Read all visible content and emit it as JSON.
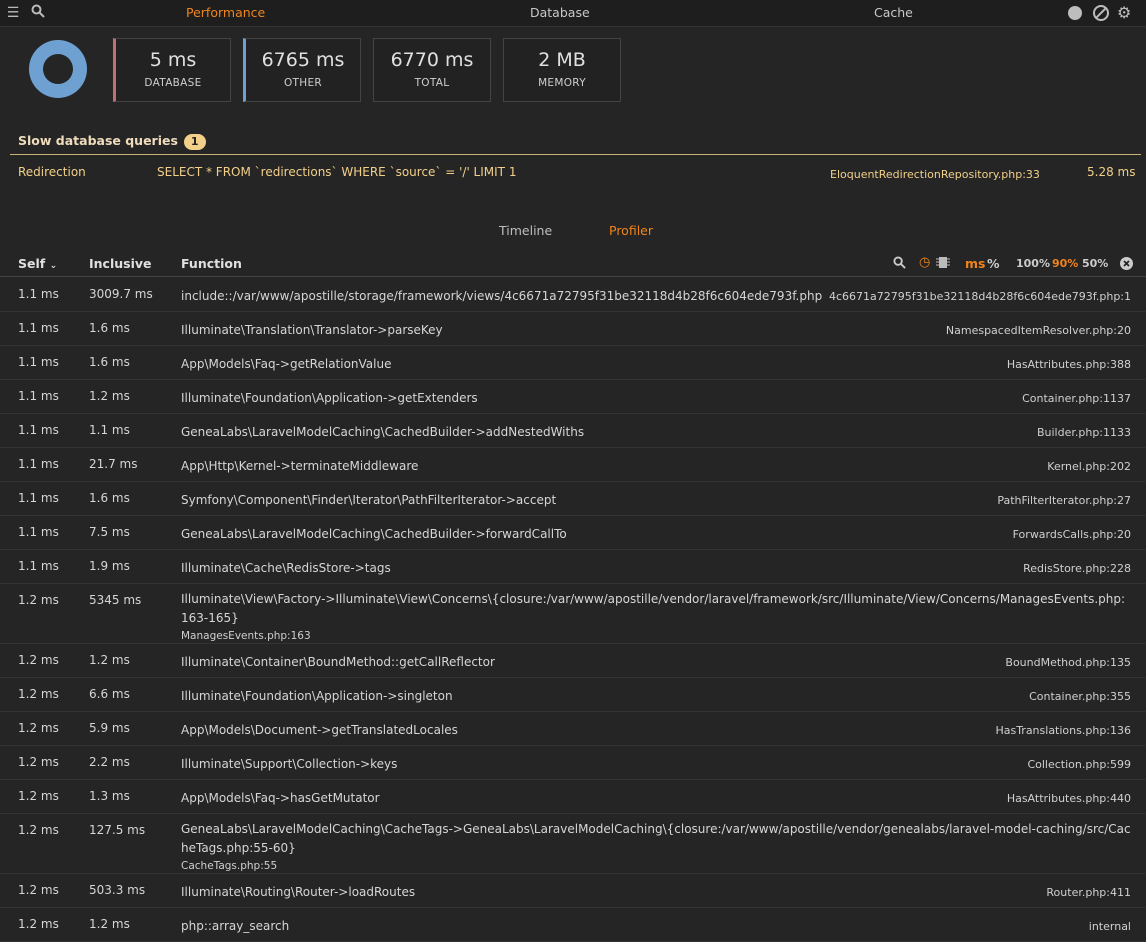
{
  "topbar": {
    "tabs": [
      "Performance",
      "Database",
      "Cache"
    ],
    "active_tab": "Performance",
    "icons": [
      "sidebar-toggle-icon",
      "search-icon",
      "record-icon",
      "clear-icon",
      "gear-icon"
    ]
  },
  "metrics": [
    {
      "value": "5 ms",
      "label": "DATABASE"
    },
    {
      "value": "6765 ms",
      "label": "OTHER"
    },
    {
      "value": "6770 ms",
      "label": "TOTAL"
    },
    {
      "value": "2 MB",
      "label": "MEMORY"
    }
  ],
  "slow_queries": {
    "title": "Slow database queries",
    "count": "1",
    "items": [
      {
        "model": "Redirection",
        "query": "SELECT * FROM `redirections` WHERE `source` = '/' LIMIT 1",
        "file": "EloquentRedirectionRepository.php:33",
        "duration": "5.28 ms"
      }
    ]
  },
  "subtabs": [
    "Timeline",
    "Profiler"
  ],
  "active_subtab": "Profiler",
  "table": {
    "headers": {
      "self": "Self",
      "inclusive": "Inclusive",
      "function": "Function"
    },
    "controls": {
      "ms": "ms",
      "percent": "%",
      "p100": "100%",
      "p90": "90%",
      "p50": "50%"
    },
    "rows": [
      {
        "self": "1.1 ms",
        "inclusive": "3009.7 ms",
        "function": "include::/var/www/apostille/storage/framework/views/4c6671a72795f31be32118d4b28f6c604ede793f.php",
        "sub": "",
        "source": "4c6671a72795f31be32118d4b28f6c604ede793f.php:1"
      },
      {
        "self": "1.1 ms",
        "inclusive": "1.6 ms",
        "function": "Illuminate\\Translation\\Translator->parseKey",
        "sub": "",
        "source": "NamespacedItemResolver.php:20"
      },
      {
        "self": "1.1 ms",
        "inclusive": "1.6 ms",
        "function": "App\\Models\\Faq->getRelationValue",
        "sub": "",
        "source": "HasAttributes.php:388"
      },
      {
        "self": "1.1 ms",
        "inclusive": "1.2 ms",
        "function": "Illuminate\\Foundation\\Application->getExtenders",
        "sub": "",
        "source": "Container.php:1137"
      },
      {
        "self": "1.1 ms",
        "inclusive": "1.1 ms",
        "function": "GeneaLabs\\LaravelModelCaching\\CachedBuilder->addNestedWiths",
        "sub": "",
        "source": "Builder.php:1133"
      },
      {
        "self": "1.1 ms",
        "inclusive": "21.7 ms",
        "function": "App\\Http\\Kernel->terminateMiddleware",
        "sub": "",
        "source": "Kernel.php:202"
      },
      {
        "self": "1.1 ms",
        "inclusive": "1.6 ms",
        "function": "Symfony\\Component\\Finder\\Iterator\\PathFilterIterator->accept",
        "sub": "",
        "source": "PathFilterIterator.php:27"
      },
      {
        "self": "1.1 ms",
        "inclusive": "7.5 ms",
        "function": "GeneaLabs\\LaravelModelCaching\\CachedBuilder->forwardCallTo",
        "sub": "",
        "source": "ForwardsCalls.php:20"
      },
      {
        "self": "1.1 ms",
        "inclusive": "1.9 ms",
        "function": "Illuminate\\Cache\\RedisStore->tags",
        "sub": "",
        "source": "RedisStore.php:228"
      },
      {
        "self": "1.2 ms",
        "inclusive": "5345 ms",
        "function": "Illuminate\\View\\Factory->Illuminate\\View\\Concerns\\{closure:/var/www/apostille/vendor/laravel/framework/src/Illuminate/View/Concerns/ManagesEvents.php:163-165}",
        "sub": "ManagesEvents.php:163",
        "source": ""
      },
      {
        "self": "1.2 ms",
        "inclusive": "1.2 ms",
        "function": "Illuminate\\Container\\BoundMethod::getCallReflector",
        "sub": "",
        "source": "BoundMethod.php:135"
      },
      {
        "self": "1.2 ms",
        "inclusive": "6.6 ms",
        "function": "Illuminate\\Foundation\\Application->singleton",
        "sub": "",
        "source": "Container.php:355"
      },
      {
        "self": "1.2 ms",
        "inclusive": "5.9 ms",
        "function": "App\\Models\\Document->getTranslatedLocales",
        "sub": "",
        "source": "HasTranslations.php:136"
      },
      {
        "self": "1.2 ms",
        "inclusive": "2.2 ms",
        "function": "Illuminate\\Support\\Collection->keys",
        "sub": "",
        "source": "Collection.php:599"
      },
      {
        "self": "1.2 ms",
        "inclusive": "1.3 ms",
        "function": "App\\Models\\Faq->hasGetMutator",
        "sub": "",
        "source": "HasAttributes.php:440"
      },
      {
        "self": "1.2 ms",
        "inclusive": "127.5 ms",
        "function": "GeneaLabs\\LaravelModelCaching\\CacheTags->GeneaLabs\\LaravelModelCaching\\{closure:/var/www/apostille/vendor/genealabs/laravel-model-caching/src/CacheTags.php:55-60}",
        "sub": "CacheTags.php:55",
        "source": ""
      },
      {
        "self": "1.2 ms",
        "inclusive": "503.3 ms",
        "function": "Illuminate\\Routing\\Router->loadRoutes",
        "sub": "",
        "source": "Router.php:411"
      },
      {
        "self": "1.2 ms",
        "inclusive": "1.2 ms",
        "function": "php::array_search",
        "sub": "",
        "source": "internal"
      }
    ]
  }
}
